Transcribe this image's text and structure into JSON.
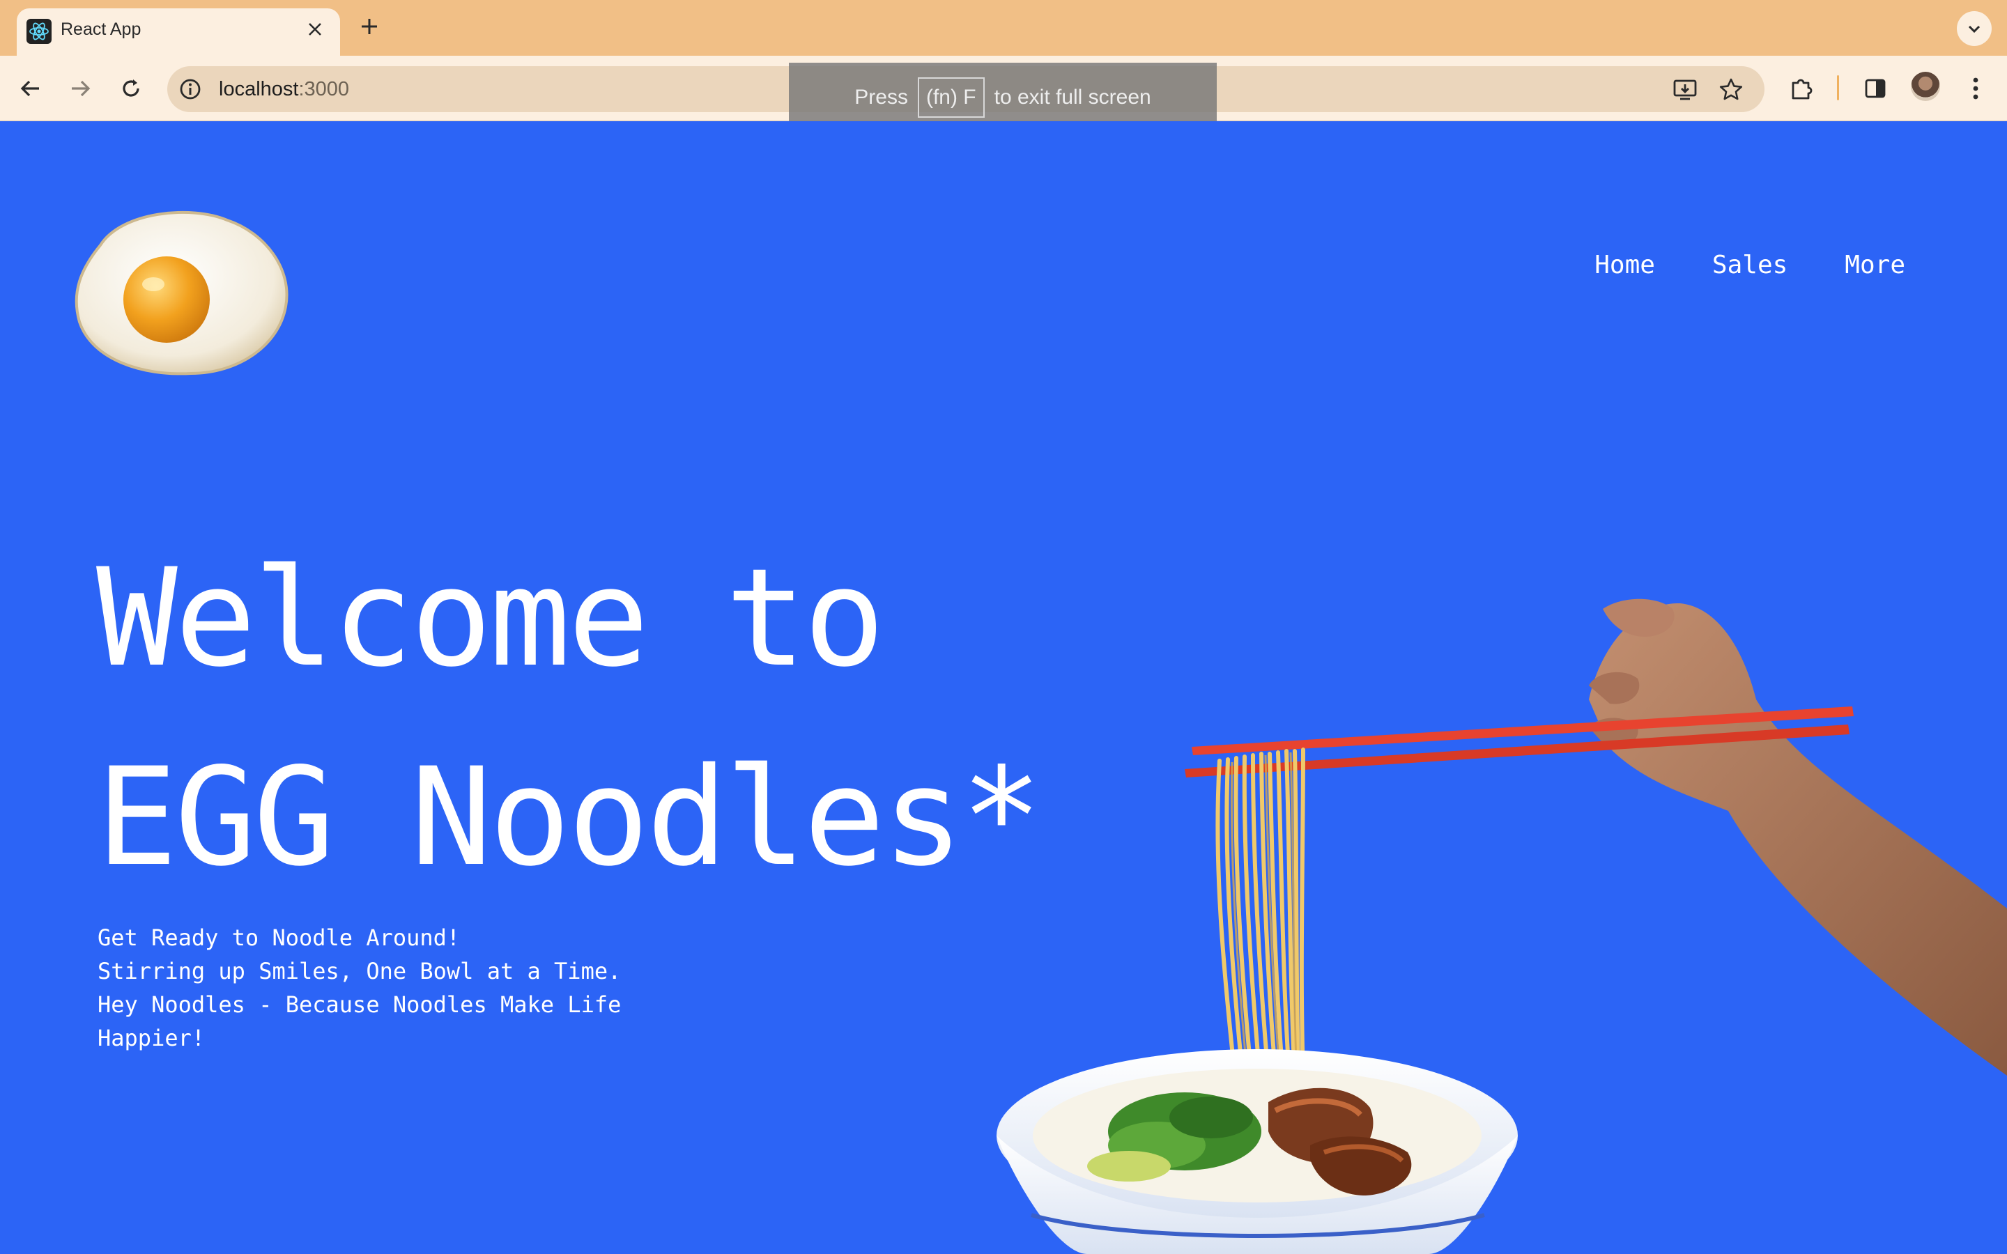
{
  "browser": {
    "tab": {
      "title": "React App",
      "favicon": "react-logo-icon",
      "close_icon": "close-icon"
    },
    "new_tab_icon": "plus-icon",
    "tab_search_icon": "chevron-down-icon",
    "toolbar": {
      "back_icon": "arrow-left-icon",
      "forward_icon": "arrow-right-icon",
      "reload_icon": "reload-icon",
      "site_info_icon": "info-icon",
      "url_host": "localhost",
      "url_port": ":3000",
      "install_icon": "install-app-icon",
      "bookmark_icon": "star-icon",
      "extensions_icon": "puzzle-icon",
      "side_panel_icon": "side-panel-icon",
      "profile_icon": "avatar",
      "menu_icon": "kebab-menu-icon"
    },
    "fullscreen_toast": {
      "prefix": "Press",
      "key": "(fn) F",
      "suffix": "to exit full screen"
    }
  },
  "page": {
    "logo": "fried-egg-logo",
    "nav": [
      "Home",
      "Sales",
      "More"
    ],
    "hero": {
      "line1": "Welcome to",
      "line2": "EGG Noodles*"
    },
    "tagline": [
      "Get Ready to Noodle Around!",
      "Stirring up Smiles, One Bowl at a Time.",
      "Hey Noodles - Because Noodles Make Life",
      "Happier!"
    ],
    "illustration": "hand-chopsticks-noodle-bowl",
    "colors": {
      "background": "#2c64f6",
      "text": "#ffffff",
      "chrome": "#f1bf86",
      "chopsticks": "#e8432f"
    }
  }
}
